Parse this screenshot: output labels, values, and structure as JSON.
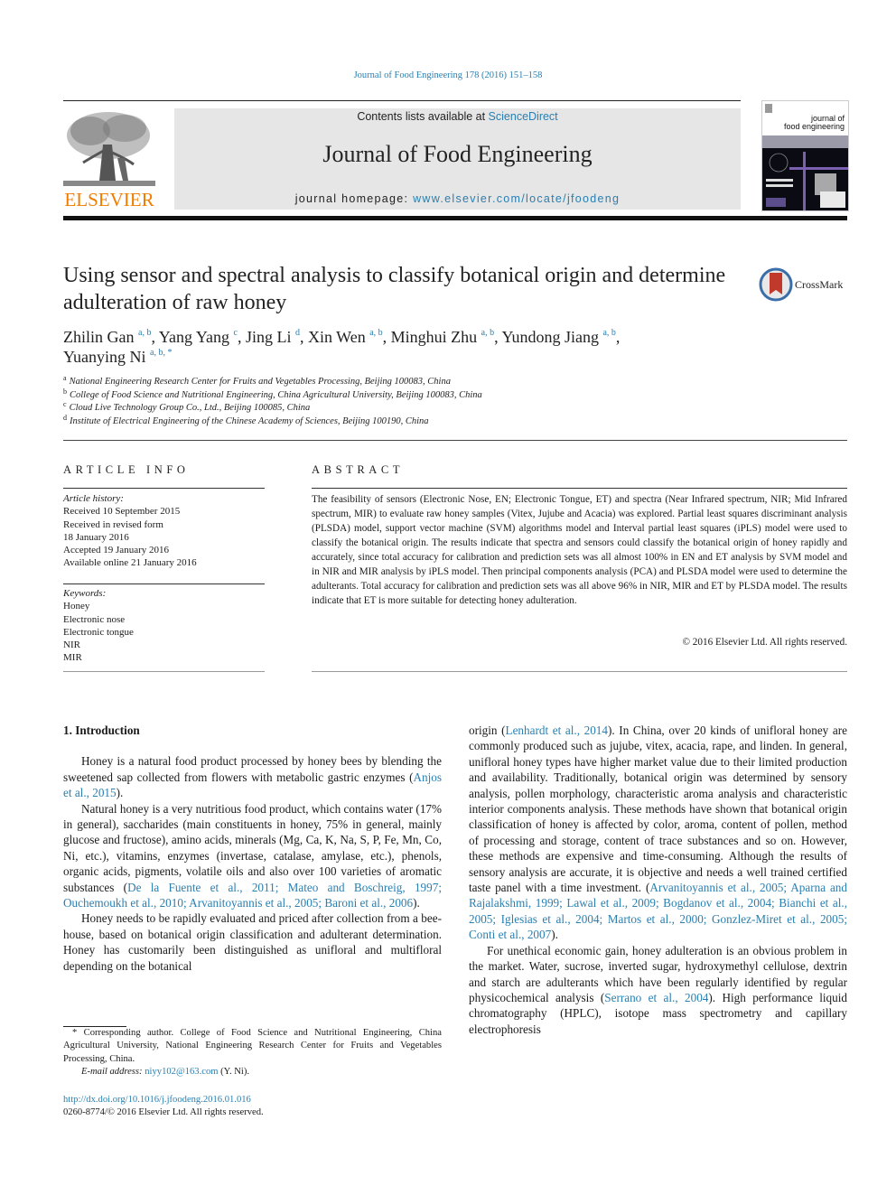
{
  "running_header": "Journal of Food Engineering 178 (2016) 151–158",
  "masthead": {
    "publisher_logo_text": "ELSEVIER",
    "contents_prefix": "Contents lists available at ",
    "contents_link": "ScienceDirect",
    "journal_name": "Journal of Food Engineering",
    "homepage_prefix": "journal homepage: ",
    "homepage_link": "www.elsevier.com/locate/jfoodeng",
    "cover_title_line1": "journal of",
    "cover_title_line2": "food engineering"
  },
  "article": {
    "title": "Using sensor and spectral analysis to classify botanical origin and determine adulteration of raw honey",
    "crossmark_label": "CrossMark",
    "authors": [
      {
        "name": "Zhilin Gan",
        "sup": "a, b",
        "sep": ", "
      },
      {
        "name": "Yang Yang",
        "sup": "c",
        "sep": ", "
      },
      {
        "name": "Jing Li",
        "sup": "d",
        "sep": ", "
      },
      {
        "name": "Xin Wen",
        "sup": "a, b",
        "sep": ", "
      },
      {
        "name": "Minghui Zhu",
        "sup": "a, b",
        "sep": ", "
      },
      {
        "name": "Yundong Jiang",
        "sup": "a, b",
        "sep": ","
      },
      {
        "name": "Yuanying Ni",
        "sup": "a, b, *",
        "sep": ""
      }
    ],
    "affiliations": [
      {
        "key": "a",
        "text": "National Engineering Research Center for Fruits and Vegetables Processing, Beijing 100083, China"
      },
      {
        "key": "b",
        "text": "College of Food Science and Nutritional Engineering, China Agricultural University, Beijing 100083, China"
      },
      {
        "key": "c",
        "text": "Cloud Live Technology Group Co., Ltd., Beijing 100085, China"
      },
      {
        "key": "d",
        "text": "Institute of Electrical Engineering of the Chinese Academy of Sciences, Beijing 100190, China"
      }
    ]
  },
  "article_info": {
    "heading": "ARTICLE INFO",
    "history_label": "Article history:",
    "history": [
      "Received 10 September 2015",
      "Received in revised form",
      "18 January 2016",
      "Accepted 19 January 2016",
      "Available online 21 January 2016"
    ],
    "keywords_label": "Keywords:",
    "keywords": [
      "Honey",
      "Electronic nose",
      "Electronic tongue",
      "NIR",
      "MIR"
    ]
  },
  "abstract": {
    "heading": "ABSTRACT",
    "text": "The feasibility of sensors (Electronic Nose, EN; Electronic Tongue, ET) and spectra (Near Infrared spec­trum, NIR; Mid Infrared spectrum, MIR) to evaluate raw honey samples (Vitex, Jujube and Acacia) was explored. Partial least squares discriminant analysis (PLSDA) model, support vector machine (SVM) al­gorithms model and Interval partial least squares (iPLS) model were used to classify the botanical origin. The results indicate that spectra and sensors could classify the botanical origin of honey rapidly and accurately, since total accuracy for calibration and prediction sets was all almost 100% in EN and ET analysis by SVM model and in NIR and MIR analysis by iPLS model. Then principal components analysis (PCA) and PLSDA model were used to determine the adulterants. Total accuracy for calibration and prediction sets was all above 96% in NIR, MIR and ET by PLSDA model. The results indicate that ET is more suitable for detecting honey adulteration.",
    "copyright": "© 2016 Elsevier Ltd. All rights reserved."
  },
  "body": {
    "intro_heading": "1.  Introduction",
    "p1_text": "Honey is a natural food product processed by honey bees by blending the sweetened sap collected from flowers with metabolic gastric enzymes (",
    "p1_cite": "Anjos et al., 2015",
    "p1_end": ").",
    "p2_text": "Natural honey is a very nutritious food product, which contains water (17% in general), saccharides (main constituents in honey, 75% in general, mainly glucose and fructose), amino acids, minerals (Mg, Ca, K, Na, S, P, Fe, Mn, Co, Ni, etc.), vitamins, enzymes (inver­tase, catalase, amylase, etc.), phenols, organic acids, pigments, volatile oils and also over 100 varieties of aromatic substances (",
    "p2_cite": "De la Fuente et al., 2011; Mateo and Boschreig, 1997; Ouchemoukh et al., 2010; Arvanitoyannis et al., 2005; Baroni et al., 2006",
    "p2_end": ").",
    "p3_text": "Honey needs to be rapidly evaluated and priced after collection from a bee-house, based on botanical origin classification and adulterant determination. Honey has customarily been distin­guished as unifloral and multifloral depending on the botanical",
    "p3b_start": "origin (",
    "p3b_cite1": "Lenhardt et al., 2014",
    "p3b_text": "). In China, over 20 kinds of unifloral honey are commonly produced such as jujube, vitex, acacia, rape, and linden. In general, unifloral honey types have higher market value due to their limited production and availability. Traditionally, botanical origin was determined by sensory analysis, pollen morphology, characteristic aroma analysis and characteristic inte­rior components analysis. These methods have shown that botan­ical origin classification of honey is affected by color, aroma, content of pollen, method of processing and storage, content of trace sub­stances and so on. However, these methods are expensive and time-consuming. Although the results of sensory analysis are ac­curate, it is objective and needs a well trained certified taste panel with a time investment. (",
    "p3b_cite2": "Arvanitoyannis et al., 2005; Aparna and Rajalakshmi, 1999; Lawal et al., 2009; Bogdanov et al., 2004; Bianchi et al., 2005; Iglesias et al., 2004; Martos et al., 2000; Gonzlez-Miret et al., 2005; Conti et al., 2007",
    "p3b_end": ").",
    "p4_text": "For unethical economic gain, honey adulteration is an obvious problem in the market. Water, sucrose, inverted sugar, hydrox­ymethyl cellulose, dextrin and starch are adulterants which have been regularly identified by regular physicochemical analysis (",
    "p4_cite": "Serrano et al., 2004",
    "p4_end": "). High performance liquid chromatography (HPLC), isotope mass spectrometry and capillary electrophoresis"
  },
  "footnotes": {
    "corresponding": "* Corresponding author. College of Food Science and Nutritional Engineering, China Agricultural University, National Engineering Research Center for Fruits and Vegetables Processing, China.",
    "email_label": "E-mail address: ",
    "email": "niyy102@163.com",
    "email_suffix": " (Y. Ni).",
    "doi": "http://dx.doi.org/10.1016/j.jfoodeng.2016.01.016",
    "issn_copyright": "0260-8774/© 2016 Elsevier Ltd. All rights reserved."
  },
  "colors": {
    "link": "#2a7fb0",
    "elsevier_orange": "#f07d00",
    "masthead_bg": "#e6e6e6"
  }
}
